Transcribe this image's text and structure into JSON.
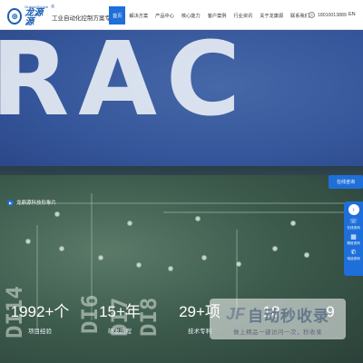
{
  "header": {
    "logo": {
      "en": "DragonSource",
      "cn": "龙源源",
      "reg": "®",
      "mark": "AA"
    },
    "slogan": "工业自动化控制方案专家",
    "nav": [
      {
        "label": "首页",
        "active": true
      },
      {
        "label": "解决方案",
        "active": false
      },
      {
        "label": "产品中心",
        "active": false
      },
      {
        "label": "核心能力",
        "active": false
      },
      {
        "label": "客户案例",
        "active": false
      },
      {
        "label": "行业资讯",
        "active": false
      },
      {
        "label": "关于龙康源",
        "active": false
      },
      {
        "label": "联系我们",
        "active": false
      }
    ],
    "phone": "18010013889",
    "phone_icon": "phone-icon",
    "lang": "EN"
  },
  "hero": {
    "big_letters": "RAC",
    "caption": "龙鼎源科技形象片",
    "board_labels": [
      "DI14",
      "DI6",
      "DI7",
      "DI8"
    ]
  },
  "stats": [
    {
      "value": "1992+个",
      "label": "项目经验"
    },
    {
      "value": "15+年",
      "label": "研发历程"
    },
    {
      "value": "29+项",
      "label": "技术专利"
    },
    {
      "value": "18",
      "label": ""
    },
    {
      "value": "9",
      "label": ""
    }
  ],
  "side": {
    "consult": "在线咨询",
    "collapse_icon": "chevron-right-icon",
    "tools": [
      {
        "icon": "chat-icon",
        "label": "在线咨询"
      },
      {
        "icon": "qrcode-icon",
        "label": "微信咨询"
      },
      {
        "icon": "phone-icon",
        "label": "电话咨询"
      }
    ]
  },
  "watermark": {
    "title": "自动秒收录",
    "sub": "做上精品一键访问一次，秒收录"
  },
  "colors": {
    "accent": "#1e6fd9",
    "brand": "#1a5fb4"
  }
}
